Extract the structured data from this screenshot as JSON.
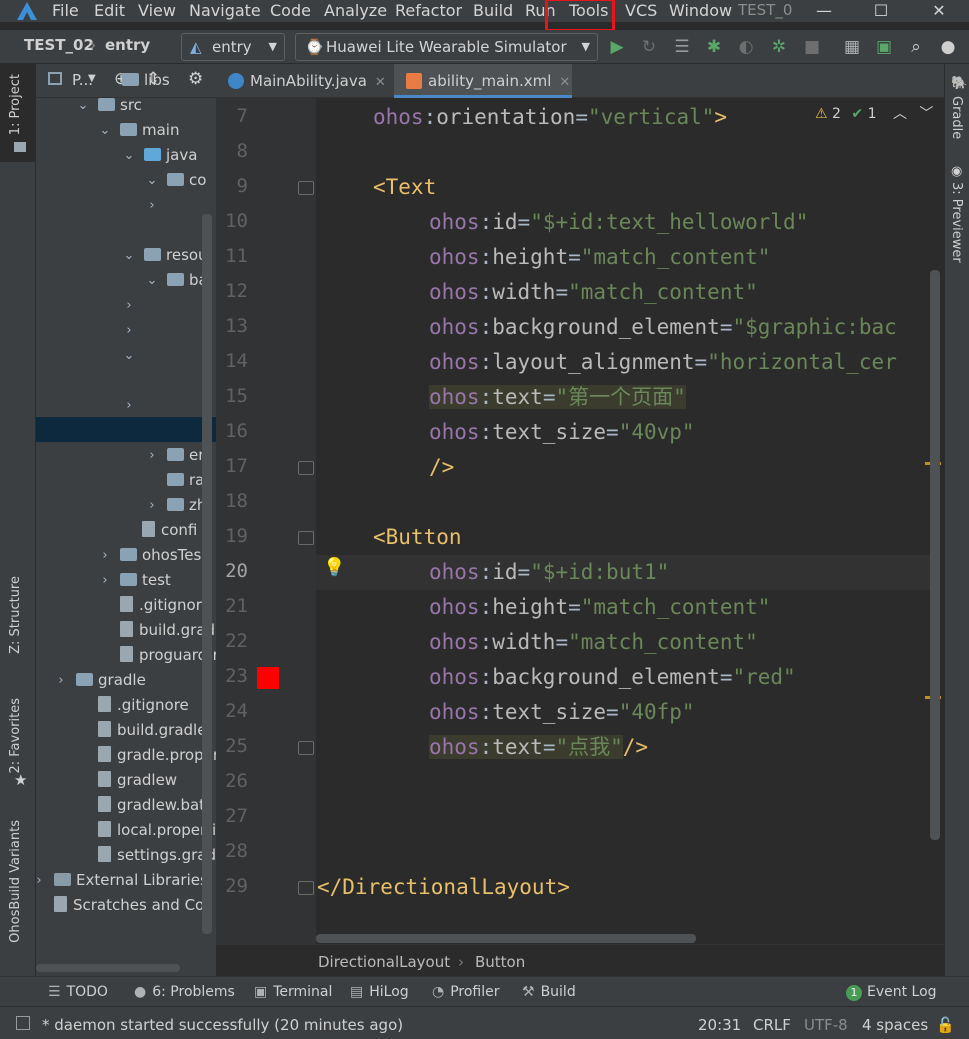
{
  "menu": {
    "items": [
      "File",
      "Edit",
      "View",
      "Navigate",
      "Code",
      "Analyze",
      "Refactor",
      "Build",
      "Run",
      "Tools",
      "VCS",
      "Window"
    ],
    "window_title": "TEST_0",
    "highlighted_item": "Tools",
    "highlight_color": "#e8141b"
  },
  "navbar": {
    "project": "TEST_02",
    "module": "entry",
    "run_config": "entry",
    "device": "Huawei Lite Wearable Simulator"
  },
  "left_strip": {
    "tabs": [
      "1: Project",
      "Z: Structure",
      "2: Favorites",
      "OhosBuild Variants"
    ]
  },
  "right_strip": {
    "tabs": [
      "Gradle",
      "3: Previewer"
    ]
  },
  "project_panel": {
    "title": "P...",
    "tree": [
      {
        "label": "libs",
        "kind": "folder"
      },
      {
        "label": "src",
        "kind": "folder"
      },
      {
        "label": "main",
        "kind": "folder"
      },
      {
        "label": "java",
        "kind": "folder-blue"
      },
      {
        "label": "co",
        "kind": "package"
      },
      {
        "label": "",
        "kind": "collapsed"
      },
      {
        "label": "resou",
        "kind": "folder-res"
      },
      {
        "label": "ba",
        "kind": "folder"
      },
      {
        "label": "",
        "kind": "collapsed"
      },
      {
        "label": "",
        "kind": "collapsed"
      },
      {
        "label": "",
        "kind": "expanded"
      },
      {
        "label": "",
        "kind": "collapsed"
      },
      {
        "label": "en",
        "kind": "folder"
      },
      {
        "label": "ra",
        "kind": "folder"
      },
      {
        "label": "zh",
        "kind": "folder"
      },
      {
        "label": "confi",
        "kind": "file"
      },
      {
        "label": "ohosTes",
        "kind": "folder"
      },
      {
        "label": "test",
        "kind": "folder"
      },
      {
        "label": ".gitignore",
        "kind": "file"
      },
      {
        "label": "build.gradl",
        "kind": "gradle"
      },
      {
        "label": "proguard-r",
        "kind": "file"
      },
      {
        "label": "gradle",
        "kind": "folder"
      },
      {
        "label": ".gitignore",
        "kind": "file"
      },
      {
        "label": "build.gradle",
        "kind": "gradle"
      },
      {
        "label": "gradle.proper",
        "kind": "file"
      },
      {
        "label": "gradlew",
        "kind": "file"
      },
      {
        "label": "gradlew.bat",
        "kind": "file"
      },
      {
        "label": "local.properti",
        "kind": "file"
      },
      {
        "label": "settings.gradle",
        "kind": "gradle"
      },
      {
        "label": "External Libraries",
        "kind": "libs"
      },
      {
        "label": "Scratches and Co",
        "kind": "scratch"
      }
    ]
  },
  "editor": {
    "tabs": [
      {
        "label": "MainAbility.java",
        "active": false
      },
      {
        "label": "ability_main.xml",
        "active": true
      }
    ],
    "inspections": {
      "warnings": "2",
      "weak_warnings": "1"
    },
    "current_line": "20",
    "lines": [
      {
        "num": "7",
        "parts": [
          [
            "ns",
            "ohos"
          ],
          [
            "pl",
            ":"
          ],
          [
            "at",
            "orientation"
          ],
          [
            "pl",
            "="
          ],
          [
            "str",
            "\"vertical\""
          ],
          [
            "tag",
            ">"
          ]
        ],
        "indent": 2
      },
      {
        "num": "8",
        "parts": [],
        "indent": 0
      },
      {
        "num": "9",
        "parts": [
          [
            "tag",
            "<Text"
          ]
        ],
        "indent": 2
      },
      {
        "num": "10",
        "parts": [
          [
            "ns",
            "ohos"
          ],
          [
            "pl",
            ":"
          ],
          [
            "at",
            "id"
          ],
          [
            "pl",
            "="
          ],
          [
            "str",
            "\"$+id:text_helloworld\""
          ]
        ],
        "indent": 4
      },
      {
        "num": "11",
        "parts": [
          [
            "ns",
            "ohos"
          ],
          [
            "pl",
            ":"
          ],
          [
            "at",
            "height"
          ],
          [
            "pl",
            "="
          ],
          [
            "str",
            "\"match_content\""
          ]
        ],
        "indent": 4
      },
      {
        "num": "12",
        "parts": [
          [
            "ns",
            "ohos"
          ],
          [
            "pl",
            ":"
          ],
          [
            "at",
            "width"
          ],
          [
            "pl",
            "="
          ],
          [
            "str",
            "\"match_content\""
          ]
        ],
        "indent": 4
      },
      {
        "num": "13",
        "parts": [
          [
            "ns",
            "ohos"
          ],
          [
            "pl",
            ":"
          ],
          [
            "at",
            "background_element"
          ],
          [
            "pl",
            "="
          ],
          [
            "str",
            "\"$graphic:bac"
          ]
        ],
        "indent": 4
      },
      {
        "num": "14",
        "parts": [
          [
            "ns",
            "ohos"
          ],
          [
            "pl",
            ":"
          ],
          [
            "at",
            "layout_alignment"
          ],
          [
            "pl",
            "="
          ],
          [
            "str",
            "\"horizontal_cer"
          ]
        ],
        "indent": 4
      },
      {
        "num": "15",
        "parts": [
          [
            "ns",
            "ohos"
          ],
          [
            "pl",
            ":"
          ],
          [
            "at",
            "text"
          ],
          [
            "pl",
            "="
          ],
          [
            "str",
            "\"第一个页面\""
          ]
        ],
        "indent": 4,
        "highlight": true
      },
      {
        "num": "16",
        "parts": [
          [
            "ns",
            "ohos"
          ],
          [
            "pl",
            ":"
          ],
          [
            "at",
            "text_size"
          ],
          [
            "pl",
            "="
          ],
          [
            "str",
            "\"40vp\""
          ]
        ],
        "indent": 4
      },
      {
        "num": "17",
        "parts": [
          [
            "tag",
            "/>"
          ]
        ],
        "indent": 4
      },
      {
        "num": "18",
        "parts": [],
        "indent": 0
      },
      {
        "num": "19",
        "parts": [
          [
            "tag",
            "<Button"
          ]
        ],
        "indent": 2
      },
      {
        "num": "20",
        "parts": [
          [
            "ns",
            "ohos"
          ],
          [
            "pl",
            ":"
          ],
          [
            "at",
            "id"
          ],
          [
            "pl",
            "="
          ],
          [
            "str",
            "\"$+id:but1\""
          ]
        ],
        "indent": 4
      },
      {
        "num": "21",
        "parts": [
          [
            "ns",
            "ohos"
          ],
          [
            "pl",
            ":"
          ],
          [
            "at",
            "height"
          ],
          [
            "pl",
            "="
          ],
          [
            "str",
            "\"match_content\""
          ]
        ],
        "indent": 4
      },
      {
        "num": "22",
        "parts": [
          [
            "ns",
            "ohos"
          ],
          [
            "pl",
            ":"
          ],
          [
            "at",
            "width"
          ],
          [
            "pl",
            "="
          ],
          [
            "str",
            "\"match_content\""
          ]
        ],
        "indent": 4
      },
      {
        "num": "23",
        "parts": [
          [
            "ns",
            "ohos"
          ],
          [
            "pl",
            ":"
          ],
          [
            "at",
            "background_element"
          ],
          [
            "pl",
            "="
          ],
          [
            "str",
            "\"red\""
          ]
        ],
        "indent": 4
      },
      {
        "num": "24",
        "parts": [
          [
            "ns",
            "ohos"
          ],
          [
            "pl",
            ":"
          ],
          [
            "at",
            "text_size"
          ],
          [
            "pl",
            "="
          ],
          [
            "str",
            "\"40fp\""
          ]
        ],
        "indent": 4
      },
      {
        "num": "25",
        "parts": [
          [
            "ns",
            "ohos"
          ],
          [
            "pl",
            ":"
          ],
          [
            "at",
            "text"
          ],
          [
            "pl",
            "="
          ],
          [
            "str",
            "\"点我\""
          ],
          [
            "tag",
            "/>"
          ]
        ],
        "indent": 4,
        "highlight": true
      },
      {
        "num": "26",
        "parts": [],
        "indent": 0
      },
      {
        "num": "27",
        "parts": [],
        "indent": 0
      },
      {
        "num": "28",
        "parts": [],
        "indent": 0
      },
      {
        "num": "29",
        "parts": [
          [
            "tag",
            "</DirectionalLayout>"
          ]
        ],
        "indent": 0
      }
    ],
    "color_swatch": "#ff0000",
    "breadcrumbs": [
      "DirectionalLayout",
      "Button"
    ]
  },
  "bottom_tools": [
    {
      "label": "TODO",
      "icon": "list-icon"
    },
    {
      "label": "6: Problems",
      "icon": "info-icon"
    },
    {
      "label": "Terminal",
      "icon": "terminal-icon"
    },
    {
      "label": "HiLog",
      "icon": "hilog-icon"
    },
    {
      "label": "Profiler",
      "icon": "profiler-icon"
    },
    {
      "label": "Build",
      "icon": "hammer-icon"
    }
  ],
  "event_log": {
    "count": "1",
    "label": "Event Log"
  },
  "status": {
    "message": "* daemon started successfully (20 minutes ago)",
    "position": "20:31",
    "line_sep": "CRLF",
    "encoding": "UTF-8",
    "indent": "4 spaces"
  }
}
